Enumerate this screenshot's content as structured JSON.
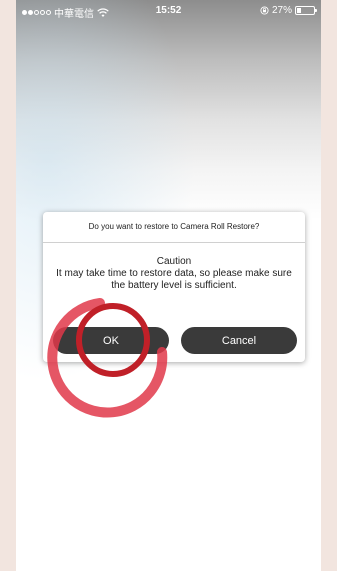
{
  "status_bar": {
    "carrier": "中華電信",
    "time": "15:52",
    "battery_text": "27%",
    "battery_level": 0.27,
    "signal_filled": 2,
    "signal_total": 5
  },
  "dialog": {
    "question": "Do you want to restore to Camera Roll Restore?",
    "caution_title": "Caution",
    "caution_text": "It may take time to restore data, so please make sure the battery level is sufficient.",
    "ok_label": "OK",
    "cancel_label": "Cancel"
  },
  "colors": {
    "button_bg": "#3a3a3a",
    "annotation_red": "#e0384a"
  },
  "icons": [
    "wifi-icon",
    "lock-rotation-icon",
    "battery-icon"
  ]
}
